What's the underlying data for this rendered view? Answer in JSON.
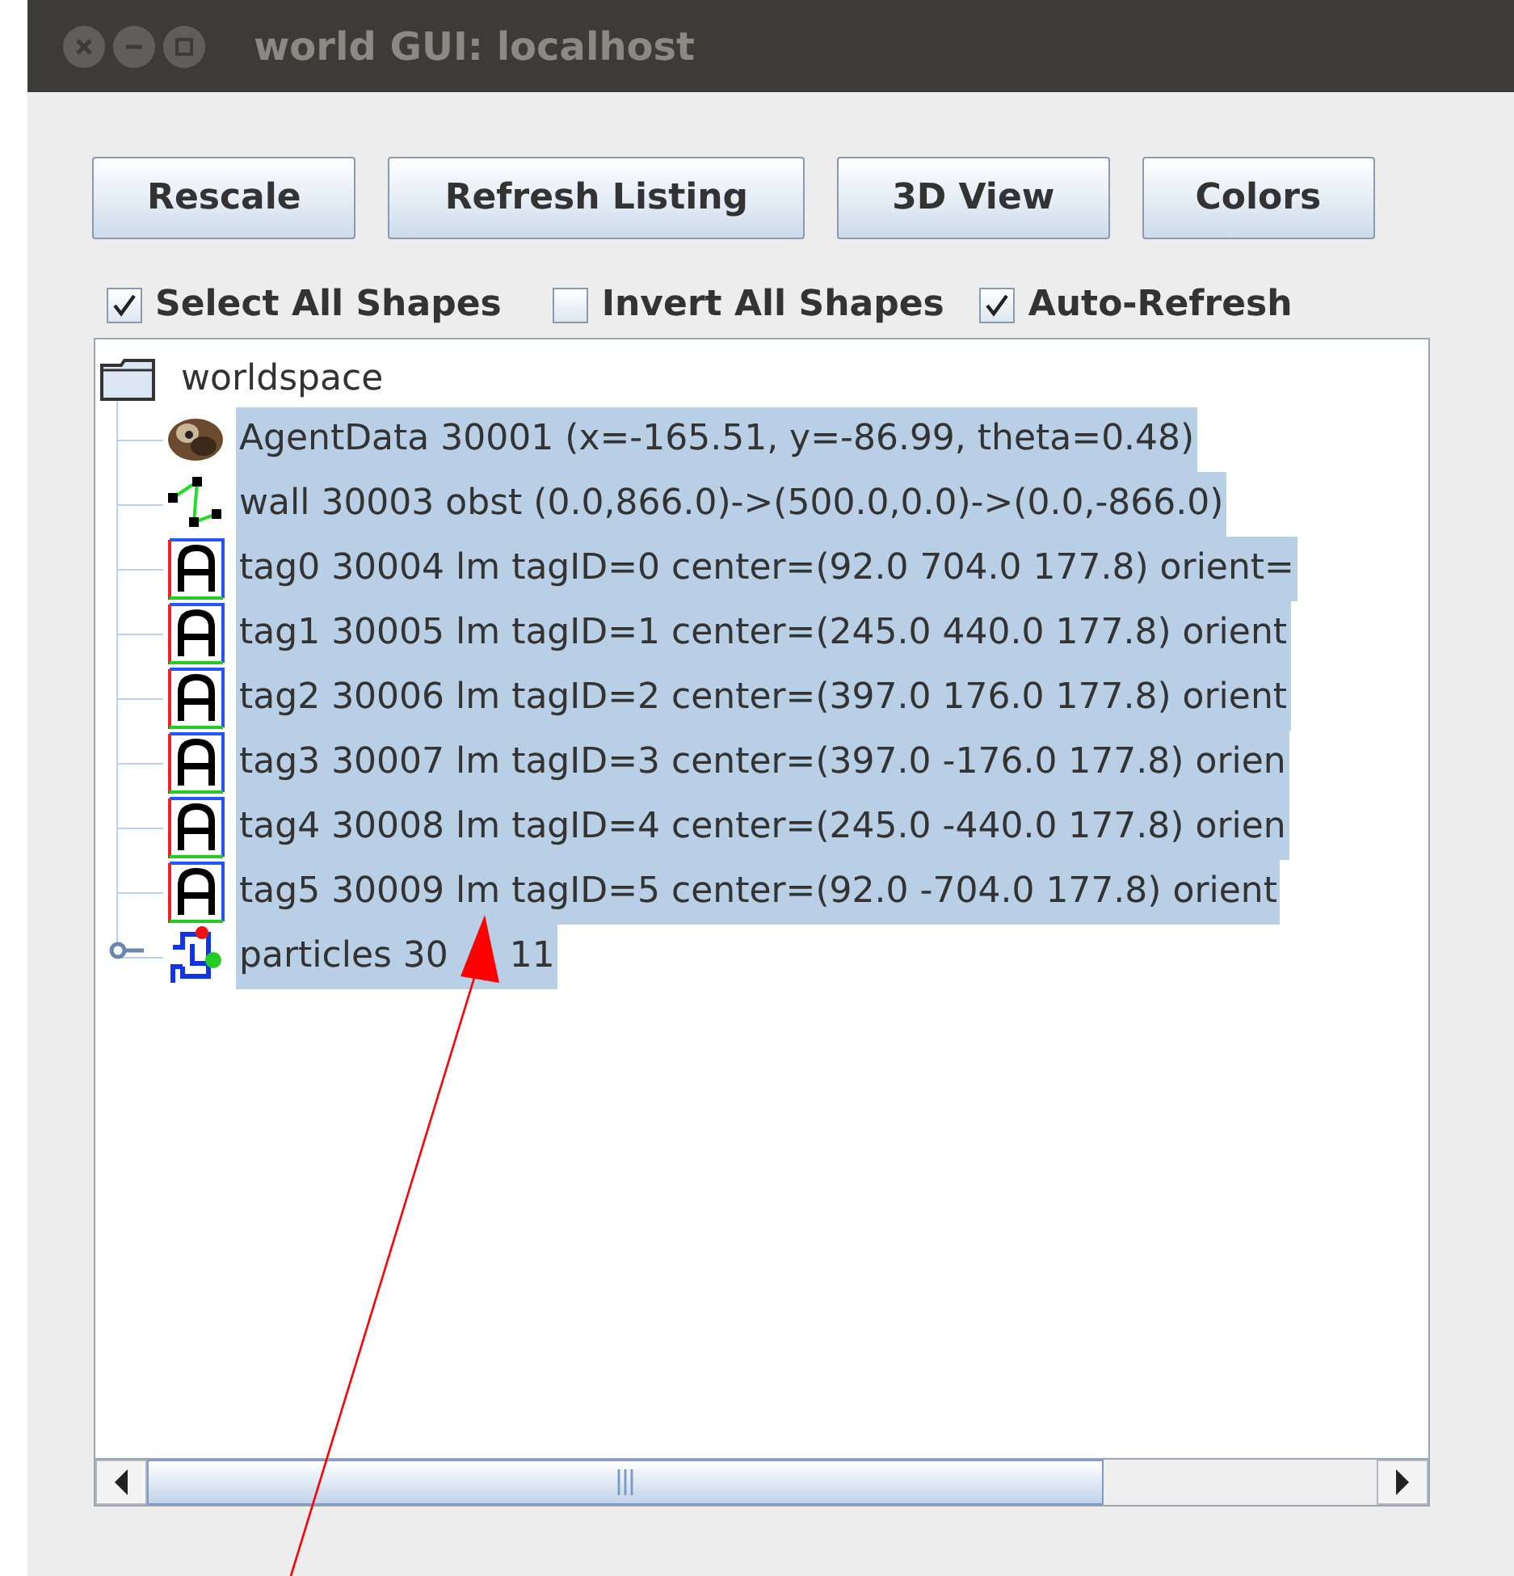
{
  "window": {
    "title": "world GUI: localhost"
  },
  "buttons": [
    "Rescale",
    "Refresh Listing",
    "3D View",
    "Colors"
  ],
  "options": [
    {
      "label": "Select All Shapes",
      "checked": true
    },
    {
      "label": "Invert All Shapes",
      "checked": false
    },
    {
      "label": "Auto-Refresh",
      "checked": true
    }
  ],
  "tree": {
    "label": "worldspace",
    "selected": false,
    "children": [
      {
        "kind": "agent",
        "label": "AgentData 30001 (x=-165.51, y=-86.99, theta=0.48)",
        "selected": true
      },
      {
        "kind": "wall",
        "label": "wall 30003 obst (0.0,866.0)->(500.0,0.0)->(0.0,-866.0)",
        "selected": true
      },
      {
        "kind": "tag",
        "label": "tag0 30004 lm tagID=0 center=(92.0 704.0 177.8) orient=",
        "selected": true
      },
      {
        "kind": "tag",
        "label": "tag1 30005 lm tagID=1 center=(245.0 440.0 177.8) orient",
        "selected": true
      },
      {
        "kind": "tag",
        "label": "tag2 30006 lm tagID=2 center=(397.0 176.0 177.8) orient",
        "selected": true
      },
      {
        "kind": "tag",
        "label": "tag3 30007 lm tagID=3 center=(397.0 -176.0 177.8) orien",
        "selected": true
      },
      {
        "kind": "tag",
        "label": "tag4 30008 lm tagID=4 center=(245.0 -440.0 177.8) orien",
        "selected": true
      },
      {
        "kind": "tag",
        "label": "tag5 30009 lm tagID=5 center=(92.0 -704.0 177.8) orient",
        "selected": true
      },
      {
        "kind": "particles",
        "label": "particles 30",
        "label_after_arrow": "11",
        "selected": true,
        "expanded": false
      }
    ]
  }
}
